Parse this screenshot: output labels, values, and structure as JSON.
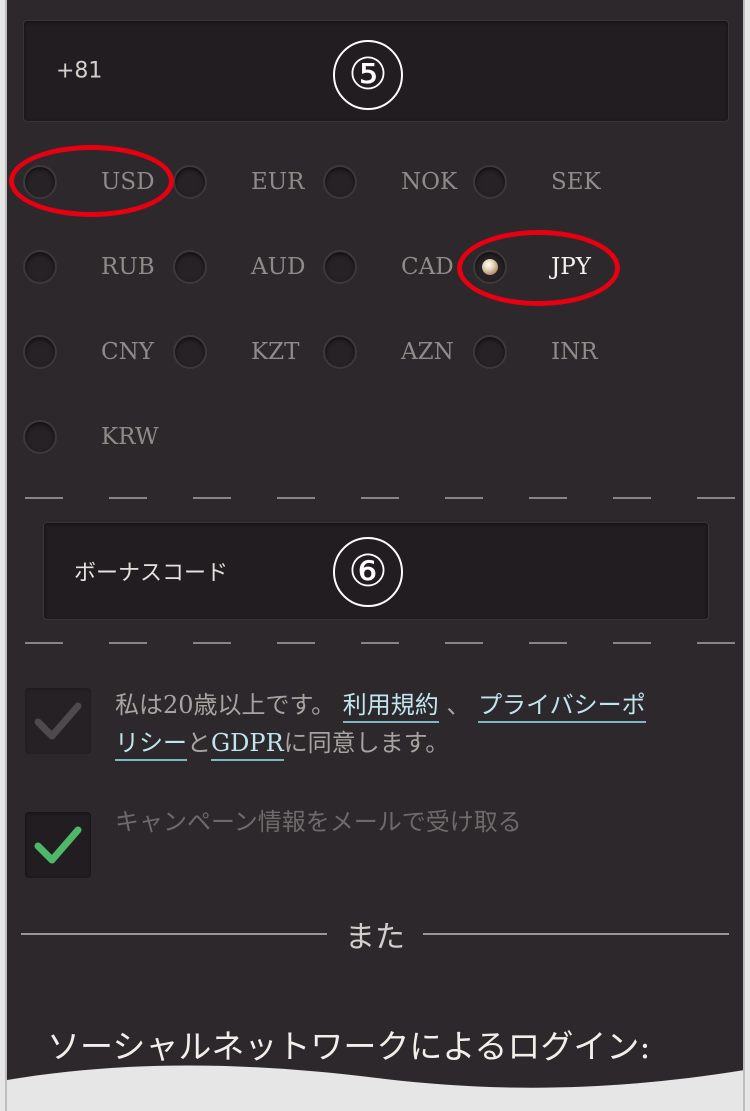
{
  "phone": {
    "value": "+81"
  },
  "steps": {
    "phone": "⑤",
    "bonus": "⑥"
  },
  "currencies": [
    {
      "code": "USD",
      "selected": false,
      "highlighted": true
    },
    {
      "code": "EUR",
      "selected": false,
      "highlighted": false
    },
    {
      "code": "NOK",
      "selected": false,
      "highlighted": false
    },
    {
      "code": "SEK",
      "selected": false,
      "highlighted": false
    },
    {
      "code": "RUB",
      "selected": false,
      "highlighted": false
    },
    {
      "code": "AUD",
      "selected": false,
      "highlighted": false
    },
    {
      "code": "CAD",
      "selected": false,
      "highlighted": false
    },
    {
      "code": "JPY",
      "selected": true,
      "highlighted": true
    },
    {
      "code": "CNY",
      "selected": false,
      "highlighted": false
    },
    {
      "code": "KZT",
      "selected": false,
      "highlighted": false
    },
    {
      "code": "AZN",
      "selected": false,
      "highlighted": false
    },
    {
      "code": "INR",
      "selected": false,
      "highlighted": false
    },
    {
      "code": "KRW",
      "selected": false,
      "highlighted": false
    }
  ],
  "bonus": {
    "placeholder": "ボーナスコード"
  },
  "terms": {
    "checked": true,
    "line1_prefix": "私は20歳以上です。",
    "link_terms": "利用規約",
    "sep": "、",
    "link_privacy_part1": "プライバシーポ",
    "link_privacy_part2": "リシー",
    "and": "と",
    "link_gdpr": "GDPR",
    "suffix": "に同意します。"
  },
  "campaign": {
    "checked": true,
    "label": "キャンペーン情報をメールで受け取る"
  },
  "divider": {
    "label": "また"
  },
  "social": {
    "title": "ソーシャルネットワークによるログイン:"
  },
  "colors": {
    "panel": "#2d282b",
    "field": "#221d20",
    "annotation": "#e60012",
    "link": "#bfe5ee",
    "check": "#4fb868"
  }
}
